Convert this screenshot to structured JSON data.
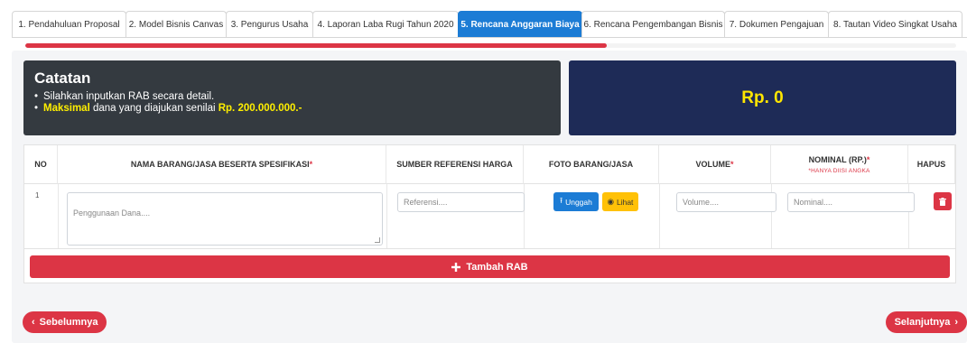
{
  "tabs": [
    {
      "label": "1. Pendahuluan Proposal",
      "active": false
    },
    {
      "label": "2. Model Bisnis Canvas",
      "active": false
    },
    {
      "label": "3. Pengurus Usaha",
      "active": false
    },
    {
      "label": "4. Laporan Laba Rugi Tahun 2020",
      "active": false
    },
    {
      "label": "5. Rencana Anggaran Biaya",
      "active": true
    },
    {
      "label": "6. Rencana Pengembangan Bisnis",
      "active": false
    },
    {
      "label": "7. Dokumen Pengajuan",
      "active": false
    },
    {
      "label": "8. Tautan Video Singkat Usaha",
      "active": false
    }
  ],
  "progress": {
    "fraction": 0.625,
    "color": "#dc3545"
  },
  "notes": {
    "title": "Catatan",
    "line1": "Silahkan inputkan RAB secara detail.",
    "line2_highlight": "Maksimal",
    "line2_text": " dana yang diajukan senilai ",
    "line2_amount": "Rp. 200.000.000.-"
  },
  "total": {
    "value": "Rp. 0"
  },
  "table": {
    "headers": {
      "no": "NO",
      "name": "NAMA BARANG/JASA BESERTA SPESIFIKASI",
      "name_required": "*",
      "source": "SUMBER REFERENSI HARGA",
      "photo": "FOTO BARANG/JASA",
      "volume": "VOLUME",
      "volume_required": "*",
      "nominal": "NOMINAL (RP.)",
      "nominal_required": "*",
      "nominal_hint": "*HANYA DIISI ANGKA",
      "delete": "HAPUS"
    },
    "rows": [
      {
        "no": "1",
        "name_placeholder": "Penggunaan Dana....",
        "source_placeholder": "Referensi....",
        "upload_label": "Unggah",
        "view_label": "Lihat",
        "volume_placeholder": "Volume....",
        "nominal_placeholder": "Nominal...."
      }
    ]
  },
  "add_button": {
    "label": "Tambah RAB",
    "icon": "plus-icon"
  },
  "nav": {
    "prev_label": "Sebelumnya",
    "next_label": "Selanjutnya"
  },
  "colors": {
    "primary": "#1c7cd5",
    "danger": "#dc3545",
    "warning": "#ffc107",
    "dark": "#343a40",
    "navy": "#1e2b57",
    "highlight": "#ffef00"
  }
}
